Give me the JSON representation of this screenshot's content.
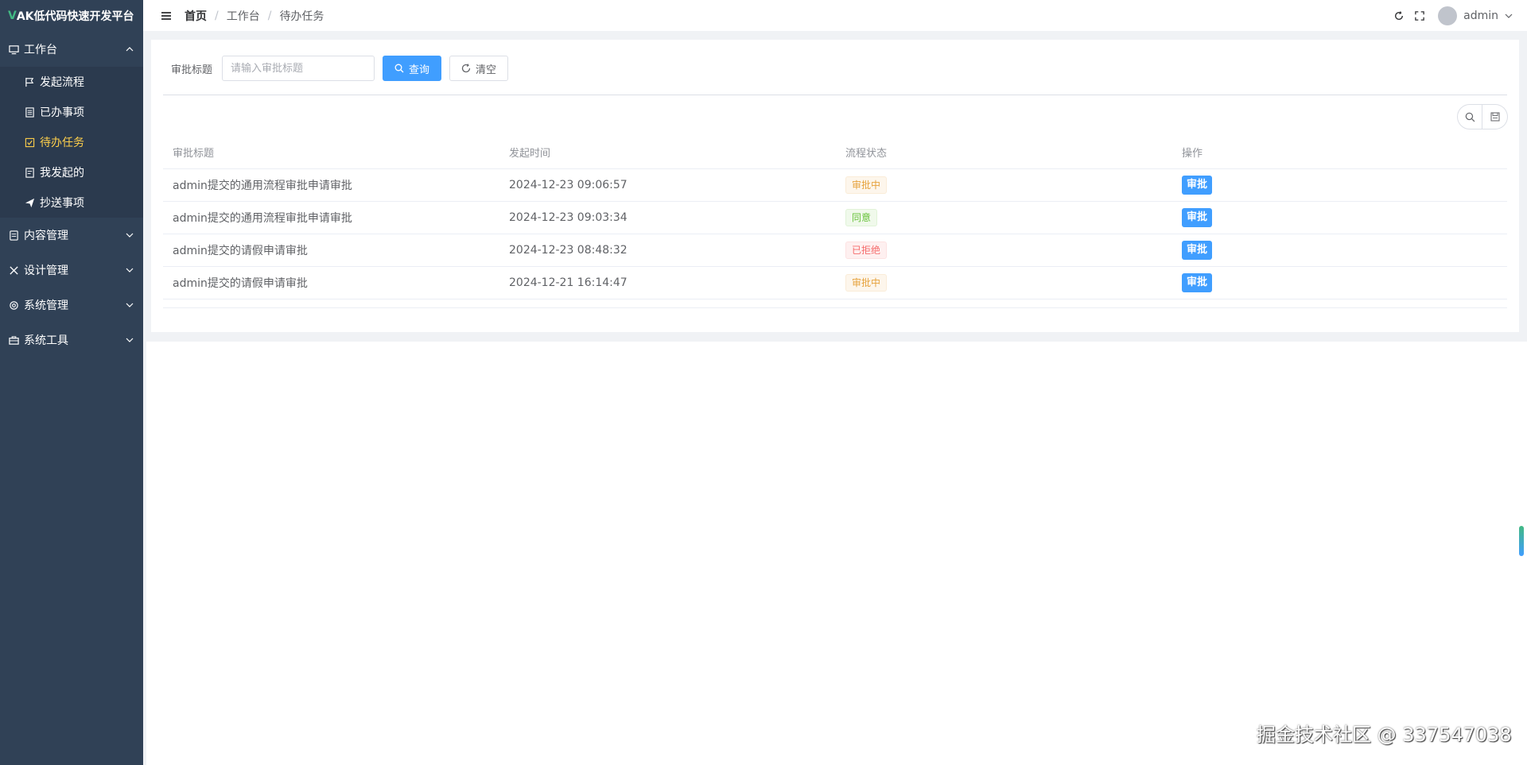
{
  "app": {
    "logo_prefix": "V",
    "logo_title": "AK低代码快速开发平台"
  },
  "sidebar": {
    "groups": [
      {
        "label": "工作台",
        "expanded": true,
        "icon": "monitor-icon"
      },
      {
        "label": "内容管理",
        "expanded": false,
        "icon": "document-icon"
      },
      {
        "label": "设计管理",
        "expanded": false,
        "icon": "tools-icon"
      },
      {
        "label": "系统管理",
        "expanded": false,
        "icon": "gear-icon"
      },
      {
        "label": "系统工具",
        "expanded": false,
        "icon": "toolbox-icon"
      }
    ],
    "sub_items": [
      {
        "label": "发起流程",
        "icon": "flag-icon"
      },
      {
        "label": "已办事项",
        "icon": "list-icon"
      },
      {
        "label": "待办任务",
        "icon": "checkbox-icon",
        "active": true
      },
      {
        "label": "我发起的",
        "icon": "doc-icon"
      },
      {
        "label": "抄送事项",
        "icon": "send-icon"
      }
    ]
  },
  "header": {
    "breadcrumb": [
      "首页",
      "工作台",
      "待办任务"
    ],
    "separator": "/",
    "user": "admin"
  },
  "search": {
    "label": "审批标题",
    "placeholder": "请输入审批标题",
    "query_button": "查询",
    "clear_button": "清空"
  },
  "table": {
    "headers": [
      "审批标题",
      "发起时间",
      "流程状态",
      "操作"
    ],
    "rows": [
      {
        "title": "admin提交的通用流程审批申请审批",
        "time": "2024-12-23 09:06:57",
        "status": "审批中",
        "action": "审批"
      },
      {
        "title": "admin提交的通用流程审批申请审批",
        "time": "2024-12-23 09:03:34",
        "status": "同意",
        "action": "审批"
      },
      {
        "title": "admin提交的请假申请审批",
        "time": "2024-12-23 08:48:32",
        "status": "已拒绝",
        "action": "审批"
      },
      {
        "title": "admin提交的请假申请审批",
        "time": "2024-12-21 16:14:47",
        "status": "审批中",
        "action": "审批"
      }
    ]
  },
  "watermark": "掘金技术社区 @ 337547038",
  "colors": {
    "sidebar_bg": "#304156",
    "active_menu": "#ffd04b",
    "primary": "#409eff",
    "warning": "#e6a23c",
    "success": "#67c23a",
    "danger": "#f56c6c"
  }
}
